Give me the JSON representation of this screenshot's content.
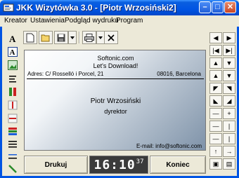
{
  "window": {
    "title": "JKK Wizytówka 3.0 - [Piotr Wrzosiński2]",
    "icon": "app-icon",
    "controls": [
      "minimize-icon",
      "maximize-icon",
      "close-icon"
    ]
  },
  "menu": {
    "items": [
      "Kreator",
      "Ustawienia",
      "Podgląd wydruku",
      "Program"
    ]
  },
  "toolbar": {
    "icons": [
      "new-icon",
      "open-icon",
      "save-icon",
      "dropdown-icon",
      "print-icon",
      "dropdown-icon",
      "delete-icon"
    ]
  },
  "card": {
    "line1": "Softonic.com",
    "line2": "Let's Download!",
    "address_left": "Adres: C/ Rosselló i Porcel, 21",
    "address_right": "08016, Barcelona",
    "name": "Piotr Wrzosiński",
    "role": "dyrektor",
    "email": "E-mail: info@softonic.com"
  },
  "buttons": {
    "print": "Drukuj",
    "end": "Koniec"
  },
  "clock": {
    "hours_minutes": "16:10",
    "seconds": "37"
  },
  "colors": {
    "titlebar": "#0054e3",
    "card_gradient_end": "#7f93a9",
    "clock_bg": "#3a3a3a"
  }
}
